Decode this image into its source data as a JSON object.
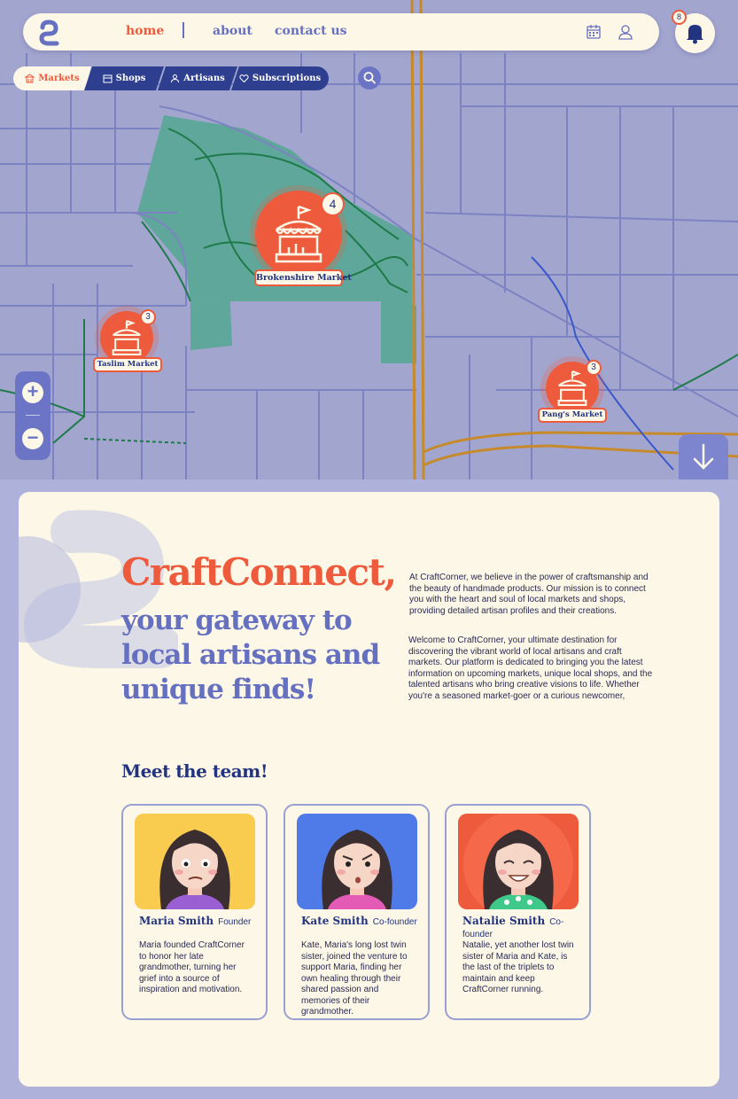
{
  "nav": {
    "home": "home",
    "about": "about",
    "contact": "contact us",
    "notifications_count": "8"
  },
  "tabs": [
    {
      "label": "Markets",
      "icon": "market-icon",
      "active": true
    },
    {
      "label": "Shops",
      "icon": "shop-icon",
      "active": false
    },
    {
      "label": "Artisans",
      "icon": "person-icon",
      "active": false
    },
    {
      "label": "Subscriptions",
      "icon": "heart-icon",
      "active": false
    }
  ],
  "map": {
    "markers": [
      {
        "name": "Brokenshire Market",
        "count": "4"
      },
      {
        "name": "Taslim Market",
        "count": "3"
      },
      {
        "name": "Pang's Market",
        "count": "3"
      }
    ],
    "zoom_in": "+",
    "zoom_out": "−"
  },
  "hero": {
    "title": "CraftConnect,",
    "subtitle": "your gateway to local artisans and unique finds!",
    "para1": "At CraftCorner, we believe in the power of craftsmanship and the beauty of handmade products. Our mission is to connect you with the heart and soul of local markets and shops, providing detailed artisan profiles and their creations.",
    "para2": "Welcome to CraftCorner, your ultimate destination for discovering the vibrant world of local artisans and craft markets. Our platform is dedicated to bringing you the latest information on upcoming markets, unique local shops, and the talented artisans who bring creative visions to life. Whether you're a seasoned market-goer or a curious newcomer,"
  },
  "team": {
    "title": "Meet the team!",
    "members": [
      {
        "name": "Maria Smith",
        "role": "Founder",
        "bio": "Maria founded CraftCorner to honor her late grandmother, turning her grief into a source of inspiration and motivation.",
        "bg": "#f9cc50"
      },
      {
        "name": "Kate Smith",
        "role": "Co-founder",
        "bio": "Kate, Maria's long lost twin sister, joined the venture to support Maria, finding her own healing through their shared passion and memories of their grandmother.",
        "bg": "#4f7be8"
      },
      {
        "name": "Natalie Smith",
        "role": "Co-founder",
        "bio": "Natalie, yet another lost twin sister of Maria and Kate, is the last of the triplets to maintain and keep CraftCorner running.",
        "bg": "#ee5a3c"
      }
    ]
  },
  "colors": {
    "accent": "#ee5a3c",
    "primary": "#6670c0",
    "navy": "#223480",
    "cream": "#fcf7e6"
  }
}
